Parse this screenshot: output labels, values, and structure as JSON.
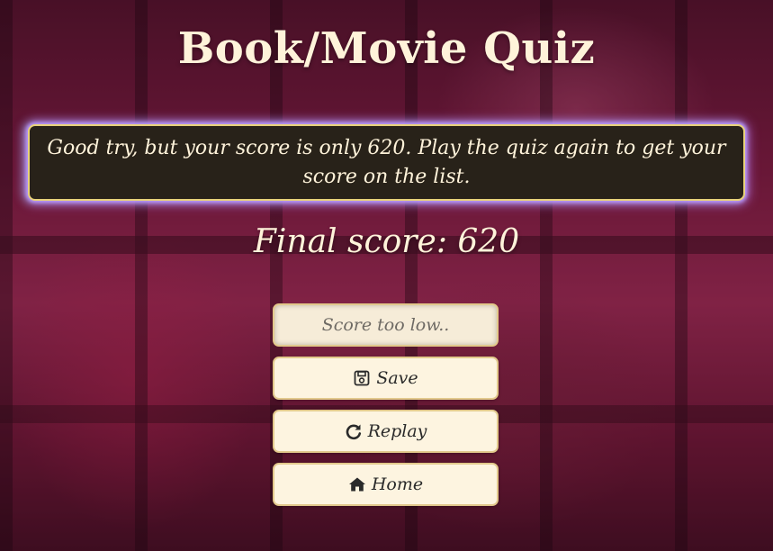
{
  "header": {
    "title": "Book/Movie Quiz"
  },
  "result": {
    "message": "Good try, but your score is only 620. Play the quiz again to get your score on the list.",
    "final_score": "Final score: 620"
  },
  "form": {
    "name_placeholder": "Score too low.."
  },
  "buttons": {
    "save": {
      "label": "Save",
      "icon": "floppy-disk-icon"
    },
    "replay": {
      "label": "Replay",
      "icon": "redo-icon"
    },
    "home": {
      "label": "Home",
      "icon": "home-icon"
    }
  },
  "colors": {
    "text_light": "#fff3da",
    "message_bg": "#282219",
    "message_border": "#e8d27a",
    "button_bg": "#fdf4e0",
    "button_border": "#e2c98c",
    "glow": "#b99cff"
  }
}
